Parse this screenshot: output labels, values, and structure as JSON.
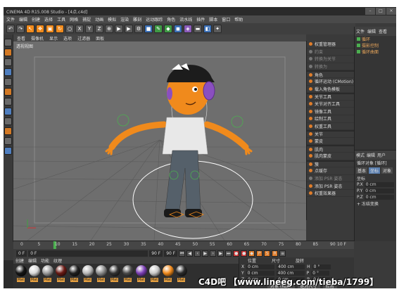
{
  "window": {
    "title": "CINEMA 4D R15.008 Studio - [4点.c4d]"
  },
  "menubar": [
    "文件",
    "编辑",
    "创建",
    "选择",
    "工具",
    "网格",
    "捕捉",
    "动画",
    "模拟",
    "渲染",
    "雕刻",
    "运动跟踪",
    "角色",
    "流水线",
    "插件",
    "脚本",
    "窗口",
    "帮助"
  ],
  "viewport": {
    "menu": [
      "查看",
      "摄像机",
      "显示",
      "选项",
      "过滤器",
      "面板"
    ],
    "label": "透视视图"
  },
  "character_menu": {
    "items": [
      {
        "label": "权重管理器",
        "dim": false
      },
      {
        "label": "约束",
        "dim": true
      },
      {
        "label": "转换为关节",
        "dim": true
      },
      {
        "label": "转换为",
        "dim": true
      },
      {
        "label": "角色",
        "dim": false,
        "sep": true
      },
      {
        "label": "循环运动 (CMotion)",
        "dim": false
      },
      {
        "label": "载入角色模板",
        "dim": false
      },
      {
        "label": "关节工具",
        "dim": false,
        "sep": true
      },
      {
        "label": "关节对齐工具",
        "dim": false
      },
      {
        "label": "镜像工具",
        "dim": false
      },
      {
        "label": "绘制工具",
        "dim": false
      },
      {
        "label": "权重工具",
        "dim": false
      },
      {
        "label": "关节",
        "dim": false,
        "sep": true
      },
      {
        "label": "蒙皮",
        "dim": false
      },
      {
        "label": "肌肉",
        "dim": false,
        "sep": true
      },
      {
        "label": "肌肉蒙皮",
        "dim": false
      },
      {
        "label": "簇",
        "dim": false,
        "sep": true
      },
      {
        "label": "点缓存",
        "dim": false
      },
      {
        "label": "添加 PSR 姿态",
        "dim": true
      },
      {
        "label": "添加 PSR 姿态",
        "dim": false
      },
      {
        "label": "权重效果器",
        "dim": false
      }
    ]
  },
  "objects_panel": {
    "tabs": [
      "文件",
      "编辑",
      "查看"
    ],
    "items": [
      "循环",
      "摄影控制",
      "循环曲面"
    ]
  },
  "attributes_panel": {
    "tabs": [
      "模式",
      "编辑",
      "用户"
    ],
    "object_label": "循环对象 [循环]",
    "subtabs": [
      "基本",
      "坐标",
      "对象"
    ],
    "section": "坐标",
    "rows": [
      {
        "axis": "P.X",
        "value": "0 cm"
      },
      {
        "axis": "P.Y",
        "value": "0 cm"
      },
      {
        "axis": "P.Z",
        "value": "0 cm"
      }
    ],
    "extra": "+ 冻结变换"
  },
  "timeline": {
    "ticks": [
      "0",
      "5",
      "10",
      "15",
      "20",
      "25",
      "30",
      "35",
      "40",
      "45",
      "50",
      "55",
      "60",
      "65",
      "70",
      "75",
      "80",
      "85",
      "90"
    ],
    "end_label": "10 F",
    "current_marker": 10
  },
  "transport": {
    "start_frame": "0 F",
    "current_frame": "0 F",
    "end_frame": "90 F",
    "max_frame": "90 F"
  },
  "materials": {
    "menu": [
      "创建",
      "编辑",
      "功能",
      "纹理"
    ],
    "items": [
      {
        "label": "Mat",
        "color": "#151515"
      },
      {
        "label": "Mat",
        "color": "#d8d8d8"
      },
      {
        "label": "Mat",
        "color": "#9a9a9a"
      },
      {
        "label": "Mat",
        "color": "#6a1a14"
      },
      {
        "label": "Mat",
        "color": "#202020"
      },
      {
        "label": "Mat",
        "color": "#b8b8b8"
      },
      {
        "label": "Mat",
        "color": "#8c8c8c"
      },
      {
        "label": "Mat",
        "color": "#333333"
      },
      {
        "label": "Mat",
        "color": "#4a4a4a"
      },
      {
        "label": "Mat",
        "color": "#7c3fb5"
      },
      {
        "label": "Mat",
        "color": "#c8c8c8"
      },
      {
        "label": "Mat",
        "color": "#f08a1c"
      },
      {
        "label": "Mat",
        "color": "#2a2a2a"
      }
    ]
  },
  "coordinates": {
    "headers": [
      "位置",
      "尺寸",
      "旋转"
    ],
    "rows": [
      {
        "axis": "X",
        "pos": "0 cm",
        "size": "400 cm",
        "rot_axis": "H",
        "rot": "0 °"
      },
      {
        "axis": "Y",
        "pos": "0 cm",
        "size": "400 cm",
        "rot_axis": "P",
        "rot": "0 °"
      },
      {
        "axis": "Z",
        "pos": "0 cm",
        "size": "0 cm",
        "rot_axis": "B",
        "rot": "0 °"
      }
    ],
    "mode_label": "对象 (相对)",
    "size_label": "绝对尺寸",
    "apply_label": "应用"
  },
  "watermark": "C4D吧 【www.lineeg.com/tieba/1799】",
  "colors": {
    "accent": "#f08a1c",
    "viewport_bg": "#6e6e6e",
    "panel_bg": "#3a3a3a"
  }
}
